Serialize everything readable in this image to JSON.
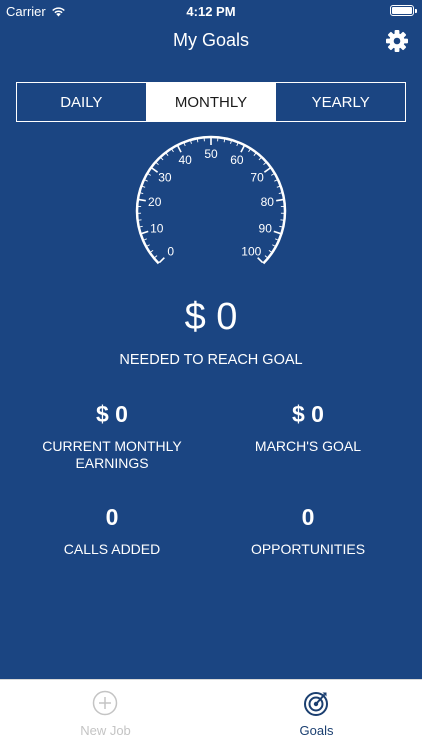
{
  "status_bar": {
    "carrier": "Carrier",
    "time": "4:12 PM"
  },
  "nav": {
    "title": "My Goals",
    "settings_icon": "gear-icon"
  },
  "segments": [
    {
      "label": "DAILY",
      "selected": false
    },
    {
      "label": "MONTHLY",
      "selected": true
    },
    {
      "label": "YEARLY",
      "selected": false
    }
  ],
  "gauge": {
    "ticks": [
      "0",
      "10",
      "20",
      "30",
      "40",
      "50",
      "60",
      "70",
      "80",
      "90",
      "100"
    ],
    "min": 0,
    "max": 100,
    "value": 0
  },
  "summary": {
    "amount": "$ 0",
    "caption": "NEEDED TO REACH GOAL"
  },
  "stats": {
    "current_earnings": {
      "value": "$ 0",
      "label": "CURRENT MONTHLY EARNINGS"
    },
    "month_goal": {
      "value": "$ 0",
      "label": "MARCH'S GOAL"
    },
    "calls_added": {
      "value": "0",
      "label": "CALLS ADDED"
    },
    "opportunities": {
      "value": "0",
      "label": "OPPORTUNITIES"
    }
  },
  "tab_bar": {
    "new_job": {
      "label": "New Job",
      "icon": "plus-circle-icon"
    },
    "goals": {
      "label": "Goals",
      "icon": "target-icon"
    }
  },
  "colors": {
    "background": "#1b4582",
    "tab_active": "#1b3f70",
    "tab_inactive": "#c4c4c4"
  }
}
